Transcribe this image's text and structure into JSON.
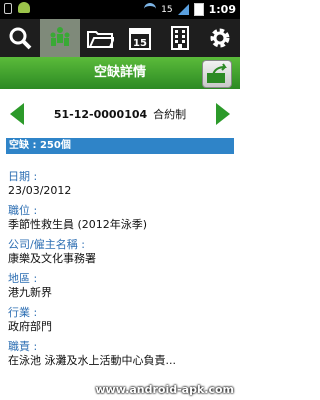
{
  "status": {
    "time": "1:09",
    "carrier_badge": "15"
  },
  "toolbar": {
    "calendar_day": "15"
  },
  "header": {
    "title": "空缺詳情"
  },
  "nav": {
    "job_number": "51-12-0000104",
    "contract_type": "合約制"
  },
  "vacancy": {
    "text": "空缺 : 250個"
  },
  "fields": [
    {
      "label": "日期 :",
      "value": "23/03/2012"
    },
    {
      "label": "職位 :",
      "value": "季節性救生員 (2012年泳季)"
    },
    {
      "label": "公司/僱主名稱 :",
      "value": "康樂及文化事務署"
    },
    {
      "label": "地區 :",
      "value": "港九新界"
    },
    {
      "label": "行業 :",
      "value": "政府部門"
    },
    {
      "label": "職責 :",
      "value": "在泳池 泳灘及水上活動中心負責..."
    }
  ],
  "watermark": "www.android-apk.com",
  "colors": {
    "accent_green": "#2c9a2a",
    "label_blue": "#2e6fb3",
    "bar_blue": "#2f84c8"
  }
}
